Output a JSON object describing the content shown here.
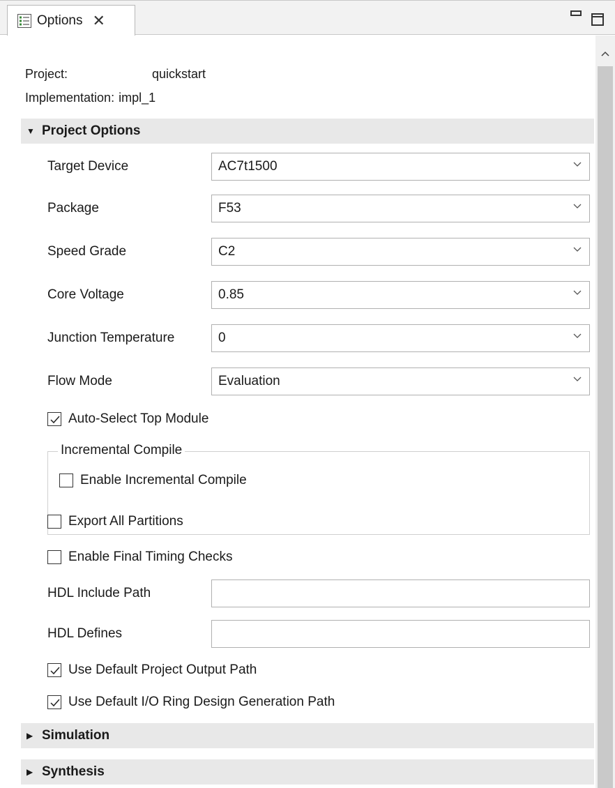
{
  "tab": {
    "label": "Options",
    "close_symbol": "✕",
    "icon": "options-list-icon"
  },
  "window_controls": {
    "minimize": "minimize-icon",
    "maximize": "maximize-icon"
  },
  "project_info": {
    "project_label": "Project:",
    "project_value": "quickstart",
    "implementation_label": "Implementation:",
    "implementation_value": "impl_1"
  },
  "sections": {
    "project_options": {
      "label": "Project Options",
      "expanded": true
    },
    "simulation": {
      "label": "Simulation",
      "expanded": false
    },
    "synthesis": {
      "label": "Synthesis",
      "expanded": false
    }
  },
  "fields": {
    "target_device": {
      "label": "Target Device",
      "value": "AC7t1500"
    },
    "package": {
      "label": "Package",
      "value": "F53"
    },
    "speed_grade": {
      "label": "Speed Grade",
      "value": "C2"
    },
    "core_voltage": {
      "label": "Core Voltage",
      "value": "0.85"
    },
    "junction_temperature": {
      "label": "Junction Temperature",
      "value": "0"
    },
    "flow_mode": {
      "label": "Flow Mode",
      "value": "Evaluation"
    },
    "hdl_include_path": {
      "label": "HDL Include Path",
      "value": ""
    },
    "hdl_defines": {
      "label": "HDL Defines",
      "value": ""
    }
  },
  "checkboxes": {
    "auto_select_top": {
      "label": "Auto-Select Top Module",
      "checked": true
    },
    "enable_incremental": {
      "label": "Enable Incremental Compile",
      "checked": false
    },
    "export_partitions": {
      "label": "Export All Partitions",
      "checked": false
    },
    "final_timing": {
      "label": "Enable Final Timing Checks",
      "checked": false
    },
    "default_output_path": {
      "label": "Use Default Project Output Path",
      "checked": true
    },
    "default_io_ring_path": {
      "label": "Use Default I/O Ring Design Generation Path",
      "checked": true
    }
  },
  "group": {
    "incremental_title": "Incremental Compile"
  },
  "colors": {
    "section_bg": "#e8e8e8",
    "border": "#b0b0b0",
    "scroll_thumb": "#c9c9c9",
    "icon_green": "#3a8a3a"
  }
}
